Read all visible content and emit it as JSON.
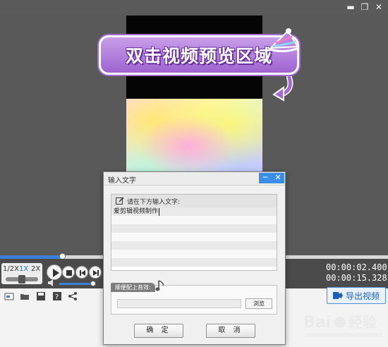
{
  "window": {
    "buttons": {
      "minimize": "▬",
      "restore": "❐",
      "close": "✕"
    }
  },
  "preview": {
    "callout_text": "双击视频预览区域"
  },
  "playback": {
    "speed_options": [
      "1/2X",
      "1X",
      "2X"
    ],
    "active_speed": "1X",
    "progress_fraction": 0.16,
    "volume_fraction": 1.0,
    "current_time": "00:00:02.400",
    "total_time": "00:00:15.328"
  },
  "toolbar": {
    "export_label": "导出视频"
  },
  "dialog": {
    "title": "输入文字",
    "minimize": "─",
    "close": "✕",
    "prompt_label": "请在下方输入文字:",
    "text_value": "爱剪辑视频制作",
    "music_label": "顺便配上音效:",
    "browse_label": "浏览",
    "music_path": "",
    "ok_label": "确 定",
    "cancel_label": "取 消"
  },
  "colors": {
    "accent": "#3c7fd6",
    "callout": "#a46bd3"
  }
}
